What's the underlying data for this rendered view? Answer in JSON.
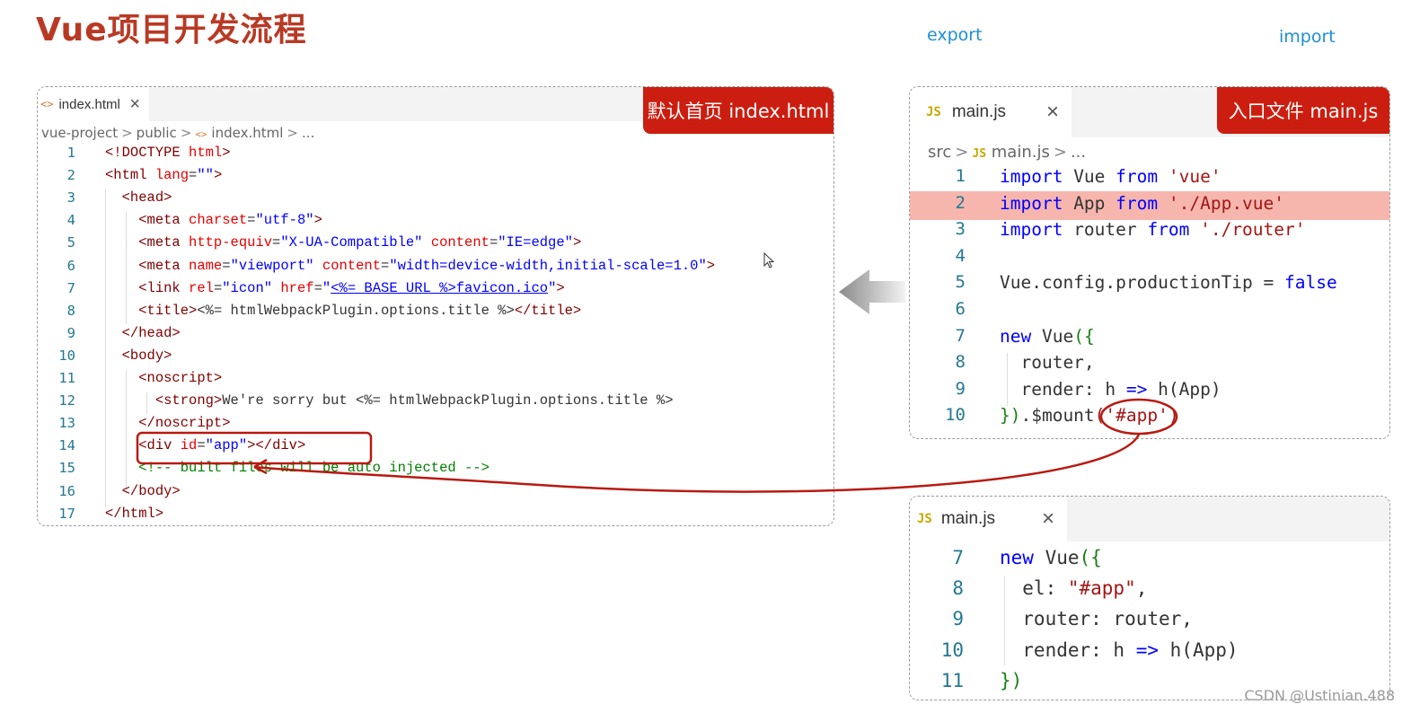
{
  "title": "Vue项目开发流程",
  "labels": {
    "export": "export",
    "import": "import"
  },
  "html_panel": {
    "tab_icon": "<>",
    "tab_name": "index.html",
    "close": "×",
    "badge": "默认首页 index.html",
    "breadcrumb": [
      "vue-project",
      "public",
      "index.html",
      "..."
    ],
    "line_numbers": [
      "1",
      "2",
      "3",
      "4",
      "5",
      "6",
      "7",
      "8",
      "9",
      "10",
      "11",
      "12",
      "13",
      "14",
      "15",
      "16",
      "17"
    ]
  },
  "main_panel": {
    "tab_icon": "JS",
    "tab_name": "main.js",
    "close": "×",
    "badge": "入口文件 main.js",
    "breadcrumb": [
      "src",
      "main.js",
      "..."
    ],
    "line_numbers": [
      "1",
      "2",
      "3",
      "4",
      "5",
      "6",
      "7",
      "8",
      "9",
      "10"
    ]
  },
  "main_panel2": {
    "tab_icon": "JS",
    "tab_name": "main.js",
    "close": "×",
    "line_numbers": [
      "7",
      "8",
      "9",
      "10",
      "11"
    ]
  },
  "watermark": "CSDN @Ustinian.488",
  "colors": {
    "accent_red": "#cc1e10",
    "title_red": "#b83a25",
    "label_blue": "#1b8fd8",
    "highlight": "#f6b6ad"
  },
  "icons": [
    "close-icon",
    "html-file-icon",
    "js-file-icon",
    "left-arrow-icon",
    "mouse-cursor-icon"
  ]
}
